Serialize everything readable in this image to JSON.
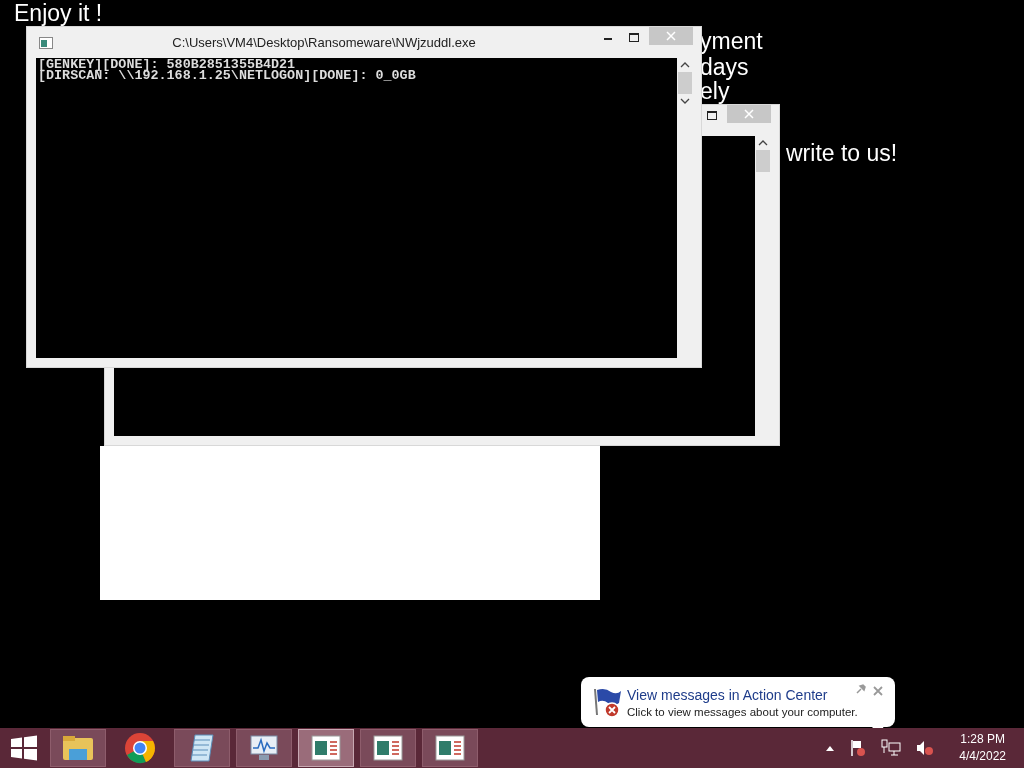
{
  "desktop_texts": [
    "Enjoy it !",
    "yment",
    "days",
    "ely",
    "write to us!"
  ],
  "windows": [
    {
      "kind": "back"
    },
    {
      "kind": "front",
      "title": "C:\\Users\\VM4\\Desktop\\Ransomeware\\NWjzuddl.exe",
      "lines": [
        "[GENKEY][DONE]: 580B2851355B4D21",
        "[DIRSCAN: \\\\192.168.1.25\\NETLOGON][DONE]: 0_0GB"
      ]
    }
  ],
  "notification": {
    "title": "View messages in Action Center",
    "message": "Click to view messages about your computer."
  },
  "taskbar": {
    "items": [
      {
        "kind": "start",
        "running": false,
        "selected": false
      },
      {
        "kind": "explorer",
        "running": true,
        "selected": false
      },
      {
        "kind": "chrome",
        "running": false,
        "selected": false
      },
      {
        "kind": "notepad",
        "running": true,
        "selected": false
      },
      {
        "kind": "monitor",
        "running": true,
        "selected": false
      },
      {
        "kind": "console",
        "running": true,
        "selected": true
      },
      {
        "kind": "console",
        "running": true,
        "selected": false
      },
      {
        "kind": "console",
        "running": true,
        "selected": false
      }
    ],
    "time": "1:28 PM",
    "date": "4/4/2022"
  }
}
